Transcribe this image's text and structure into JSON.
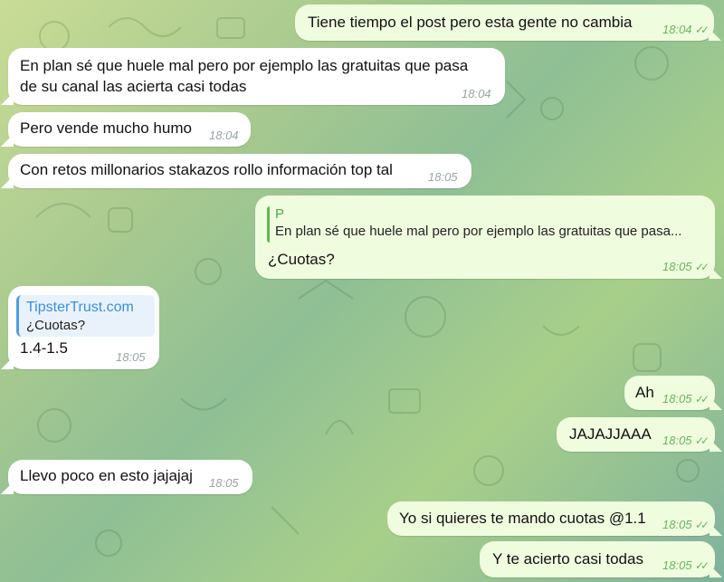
{
  "messages": [
    {
      "text": "Tiene tiempo el post pero esta gente no cambia",
      "time": "18:04"
    },
    {
      "text": "En plan sé que huele mal pero por ejemplo las gratuitas que pasa",
      "text2": "de su canal las acierta casi todas",
      "time": "18:04"
    },
    {
      "text": "Pero vende mucho humo",
      "time": "18:04"
    },
    {
      "text": "Con retos millonarios stakazos rollo información top tal",
      "time": "18:05"
    },
    {
      "reply_name": "P",
      "reply_text": "En plan sé que huele mal pero por ejemplo las gratuitas que pasa...",
      "text": "¿Cuotas?",
      "time": "18:05"
    },
    {
      "link_title": "TipsterTrust.com",
      "link_sub": "¿Cuotas?",
      "text": "1.4-1.5",
      "time": "18:05"
    },
    {
      "text": "Ah",
      "time": "18:05"
    },
    {
      "text": "JAJAJJAAA",
      "time": "18:05"
    },
    {
      "text": "Llevo poco en esto jajajaj",
      "time": "18:05"
    },
    {
      "text": "Yo si quieres te mando cuotas @1.1",
      "time": "18:05"
    },
    {
      "text": "Y te acierto casi todas",
      "time": "18:05"
    }
  ],
  "read_check": "✓✓",
  "colors": {
    "outgoing": "#effdde",
    "incoming": "#ffffff",
    "accent": "#5fb84f",
    "link": "#3d8fd6"
  }
}
